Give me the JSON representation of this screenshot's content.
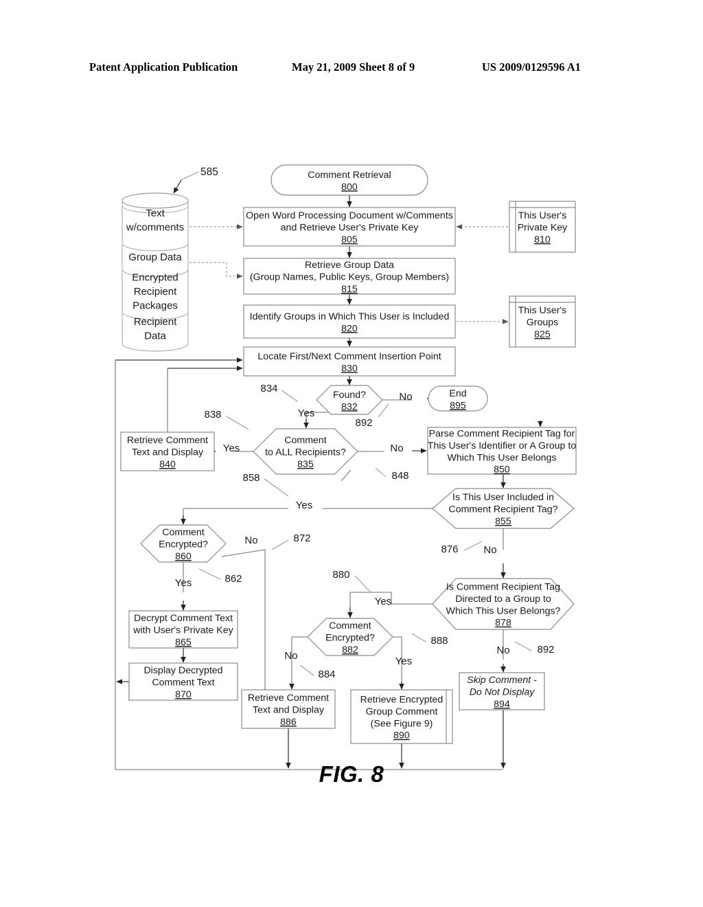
{
  "header": {
    "publication": "Patent Application Publication",
    "date_sheet": "May 21, 2009  Sheet 8 of 9",
    "patent_number": "US 2009/0129596 A1"
  },
  "figure": {
    "caption": "FIG. 8",
    "callout_585": "585"
  },
  "datastore": {
    "name": "data-store-stack",
    "sections": [
      {
        "id": "ds1",
        "lines": [
          "Text",
          "w/comments"
        ]
      },
      {
        "id": "ds2",
        "lines": [
          "Group Data"
        ]
      },
      {
        "id": "ds3",
        "lines": [
          "Encrypted",
          "Recipient",
          "Packages"
        ]
      },
      {
        "id": "ds4",
        "lines": [
          "Recipient",
          "Data"
        ]
      }
    ]
  },
  "nodes": {
    "n800": {
      "lines": [
        "Comment Retrieval"
      ],
      "ref": "800",
      "shape": "terminator"
    },
    "n805": {
      "lines": [
        "Open Word Processing Document w/Comments",
        "and Retrieve User's Private Key"
      ],
      "ref": "805",
      "shape": "process"
    },
    "n810": {
      "lines": [
        "This User's",
        "Private Key"
      ],
      "ref": "810",
      "shape": "store"
    },
    "n815": {
      "lines": [
        "Retrieve Group Data",
        "(Group Names, Public Keys, Group Members)"
      ],
      "ref": "815",
      "shape": "process"
    },
    "n820": {
      "lines": [
        "Identify Groups in Which This User is Included"
      ],
      "ref": "820",
      "shape": "process"
    },
    "n825": {
      "lines": [
        "This User's",
        "Groups"
      ],
      "ref": "825",
      "shape": "store"
    },
    "n830": {
      "lines": [
        "Locate First/Next Comment Insertion Point"
      ],
      "ref": "830",
      "shape": "process"
    },
    "n832": {
      "lines": [
        "Found?"
      ],
      "ref": "832",
      "shape": "decision"
    },
    "n835": {
      "lines": [
        "Comment",
        "to ALL Recipients?"
      ],
      "ref": "835",
      "shape": "decision"
    },
    "n840": {
      "lines": [
        "Retrieve Comment",
        "Text and Display"
      ],
      "ref": "840",
      "shape": "process"
    },
    "n850": {
      "lines": [
        "Parse Comment Recipient Tag for",
        "This User's Identifier or A Group to",
        "Which This User Belongs"
      ],
      "ref": "850",
      "shape": "process"
    },
    "n855": {
      "lines": [
        "Is This User Included in",
        "Comment Recipient Tag?"
      ],
      "ref": "855",
      "shape": "decision"
    },
    "n860": {
      "lines": [
        "Comment",
        "Encrypted?"
      ],
      "ref": "860",
      "shape": "decision"
    },
    "n865": {
      "lines": [
        "Decrypt Comment Text",
        "with User's Private Key"
      ],
      "ref": "865",
      "shape": "process"
    },
    "n870": {
      "lines": [
        "Display Decrypted",
        "Comment Text"
      ],
      "ref": "870",
      "shape": "process"
    },
    "n878": {
      "lines": [
        "Is Comment Recipient Tag",
        "Directed to a Group to",
        "Which This User Belongs?"
      ],
      "ref": "878",
      "shape": "decision"
    },
    "n882": {
      "lines": [
        "Comment",
        "Encrypted?"
      ],
      "ref": "882",
      "shape": "decision"
    },
    "n886": {
      "lines": [
        "Retrieve Comment",
        "Text and Display"
      ],
      "ref": "886",
      "shape": "process"
    },
    "n890": {
      "lines": [
        "Retrieve Encrypted",
        "Group Comment",
        "(See Figure 9)"
      ],
      "ref": "890",
      "shape": "predefined"
    },
    "n894": {
      "lines": [
        "Skip Comment -",
        "Do Not Display"
      ],
      "ref": "894",
      "shape": "process-italic"
    },
    "n895": {
      "lines": [
        "End"
      ],
      "ref": "895",
      "shape": "terminator"
    }
  },
  "edge_labels": {
    "e834": "834",
    "e838": "838",
    "e848": "848",
    "e858": "858",
    "e862": "862",
    "e872": "872",
    "e876": "876",
    "e880": "880",
    "e884": "884",
    "e888": "888",
    "e892a": "892",
    "e892b": "892",
    "yes_832": "Yes",
    "no_832": "No",
    "yes_835": "Yes",
    "no_835": "No",
    "yes_855": "Yes",
    "no_855": "No",
    "yes_860": "Yes",
    "no_860": "No",
    "yes_878": "Yes",
    "no_878": "No",
    "yes_882": "Yes",
    "no_882": "No"
  },
  "colors": {
    "ink": "#222222",
    "stroke": "#888888",
    "dashed": "#999999"
  }
}
